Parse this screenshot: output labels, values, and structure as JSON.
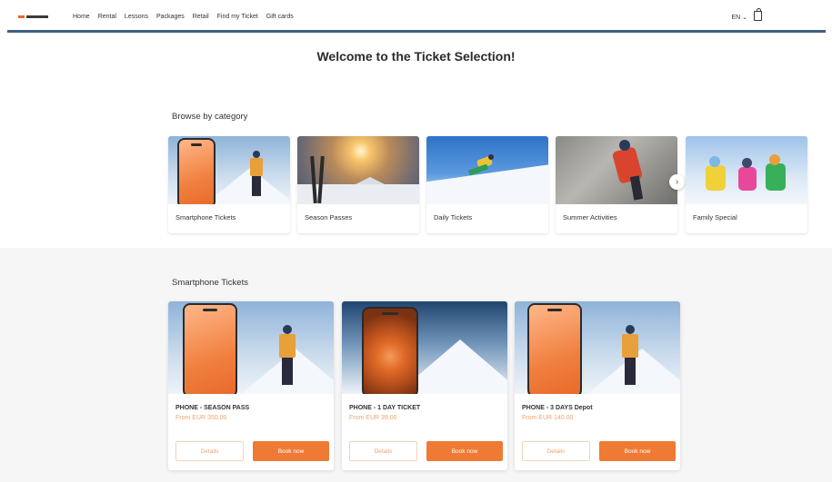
{
  "header": {
    "nav": [
      "Home",
      "Rental",
      "Lessons",
      "Packages",
      "Retail",
      "Find my Ticket",
      "Gift cards"
    ],
    "language": "EN",
    "language_chevron": "⌄"
  },
  "page_title": "Welcome to the Ticket Selection!",
  "browse": {
    "title": "Browse by category",
    "categories": [
      {
        "label": "Smartphone Tickets",
        "image": "phone-skier-image"
      },
      {
        "label": "Season Passes",
        "image": "sunset-skis-image"
      },
      {
        "label": "Daily Tickets",
        "image": "skier-slope-image"
      },
      {
        "label": "Summer Activities",
        "image": "climber-image"
      },
      {
        "label": "Family Special",
        "image": "family-snow-image"
      }
    ],
    "next_arrow": "›"
  },
  "products": {
    "title": "Smartphone Tickets",
    "items": [
      {
        "name": "PHONE - SEASON PASS",
        "price": "From EUR 350.00",
        "details": "Details",
        "book": "Book now"
      },
      {
        "name": "PHONE - 1 DAY TICKET",
        "price": "From EUR 39.00",
        "details": "Details",
        "book": "Book now"
      },
      {
        "name": "PHONE - 3 DAYS Depot",
        "price": "From EUR 140.00",
        "details": "Details",
        "book": "Book now"
      }
    ]
  },
  "colors": {
    "accent": "#ef7a34",
    "header_rule": "#3f5f82",
    "band": "#f6f6f6"
  }
}
